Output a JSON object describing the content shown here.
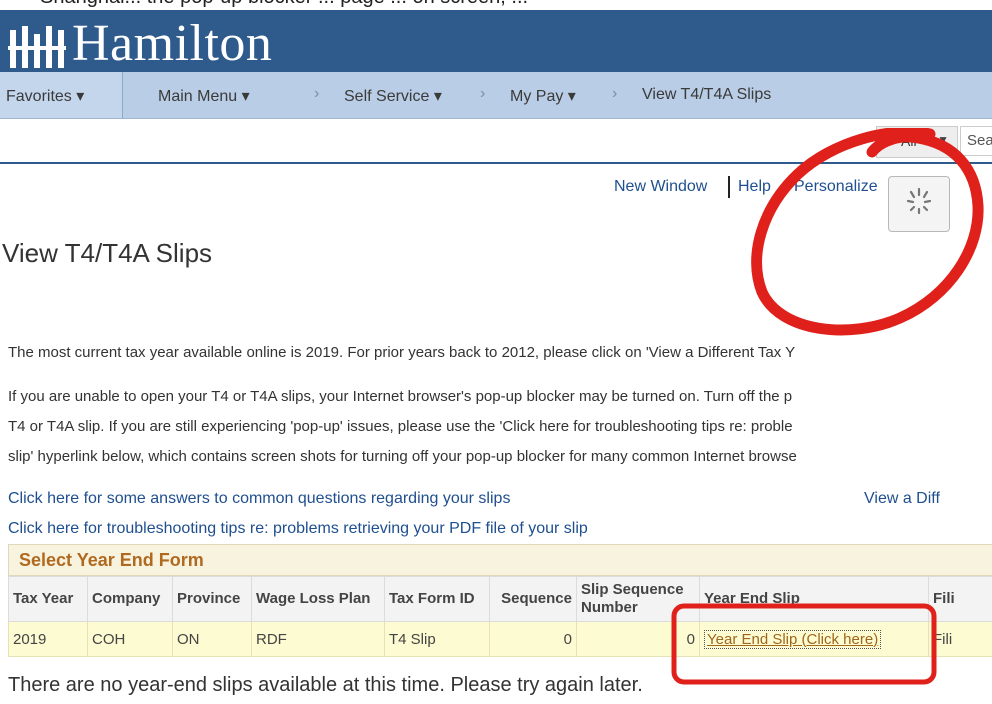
{
  "top_strip_text": "Shanghai... the pop-up blocker ... page ... on screen, ...",
  "header": {
    "logo_text": "Hamilton"
  },
  "nav": {
    "favorites": "Favorites ▾",
    "main_menu": "Main Menu ▾",
    "self_service": "Self Service ▾",
    "my_pay": "My Pay ▾",
    "current": "View T4/T4A Slips",
    "sep": "›"
  },
  "search": {
    "scope": "All",
    "placeholder": "Sea"
  },
  "links": {
    "new_window": "New Window",
    "help": "Help",
    "personalize": "Personalize"
  },
  "page": {
    "title": "View T4/T4A Slips",
    "para1": "The most current tax year available online is 2019. For prior years back to 2012, please click on 'View a Different Tax Y",
    "para2_l1": "If you are unable to open your T4 or T4A slips, your Internet browser's pop-up blocker may be turned on. Turn off the p",
    "para2_l2": "T4 or T4A slip. If you are still experiencing 'pop-up' issues, please use the 'Click here for troubleshooting tips re: proble",
    "para2_l3": "slip' hyperlink below, which contains screen shots for turning off your pop-up blocker for many common Internet browse",
    "link_answers": "Click here for some answers to common questions regarding your slips",
    "link_view_diff": "View a Diff",
    "link_troubleshoot": "Click here for troubleshooting tips re: problems retrieving your PDF file of your slip"
  },
  "grid": {
    "title": "Select Year End Form",
    "headers": [
      "Tax Year",
      "Company",
      "Province",
      "Wage Loss Plan",
      "Tax Form ID",
      "Sequence",
      "Slip Sequence Number",
      "Year End Slip",
      "Fili"
    ],
    "row": {
      "tax_year": "2019",
      "company": "COH",
      "province": "ON",
      "wage_loss_plan": "RDF",
      "tax_form_id": "T4 Slip",
      "sequence": "0",
      "slip_seq": "0",
      "year_end_slip": "Year End Slip (Click here)",
      "filing": "Fili"
    }
  },
  "note": "There are no year-end slips available at this time. Please try again later.",
  "colors": {
    "banner": "#2f5a8c",
    "nav": "#b9cde6",
    "annotation": "#e0201a",
    "link": "#1f4f8f"
  }
}
